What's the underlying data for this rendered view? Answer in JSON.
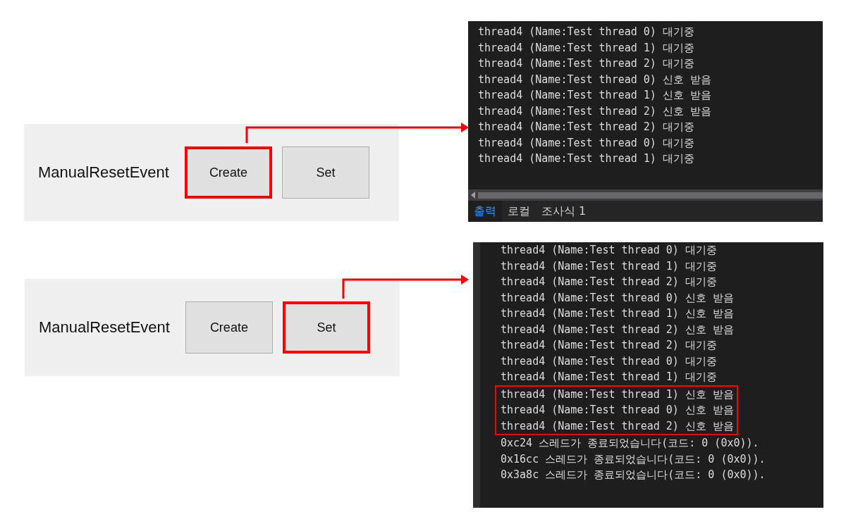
{
  "examples": [
    {
      "label": "ManualResetEvent",
      "buttons": [
        {
          "label": "Create",
          "highlighted": true
        },
        {
          "label": "Set",
          "highlighted": false
        }
      ],
      "output": {
        "lines": [
          {
            "text": "thread4 (Name:Test thread 0) 대기중",
            "highlighted": false
          },
          {
            "text": "thread4 (Name:Test thread 1) 대기중",
            "highlighted": false
          },
          {
            "text": "thread4 (Name:Test thread 2) 대기중",
            "highlighted": false
          },
          {
            "text": "thread4 (Name:Test thread 0) 신호 받음",
            "highlighted": false
          },
          {
            "text": "thread4 (Name:Test thread 1) 신호 받음",
            "highlighted": false
          },
          {
            "text": "thread4 (Name:Test thread 2) 신호 받음",
            "highlighted": false
          },
          {
            "text": "thread4 (Name:Test thread 2) 대기중",
            "highlighted": false
          },
          {
            "text": "thread4 (Name:Test thread 0) 대기중",
            "highlighted": false
          },
          {
            "text": "thread4 (Name:Test thread 1) 대기중",
            "highlighted": false
          }
        ],
        "tabs": [
          {
            "label": "출력",
            "selected": true
          },
          {
            "label": "로컬",
            "selected": false
          },
          {
            "label": "조사식 1",
            "selected": false
          }
        ]
      }
    },
    {
      "label": "ManualResetEvent",
      "buttons": [
        {
          "label": "Create",
          "highlighted": false
        },
        {
          "label": "Set",
          "highlighted": true
        }
      ],
      "output": {
        "lines": [
          {
            "text": "thread4 (Name:Test thread 0) 대기중",
            "highlighted": false
          },
          {
            "text": "thread4 (Name:Test thread 1) 대기중",
            "highlighted": false
          },
          {
            "text": "thread4 (Name:Test thread 2) 대기중",
            "highlighted": false
          },
          {
            "text": "thread4 (Name:Test thread 0) 신호 받음",
            "highlighted": false
          },
          {
            "text": "thread4 (Name:Test thread 1) 신호 받음",
            "highlighted": false
          },
          {
            "text": "thread4 (Name:Test thread 2) 신호 받음",
            "highlighted": false
          },
          {
            "text": "thread4 (Name:Test thread 2) 대기중",
            "highlighted": false
          },
          {
            "text": "thread4 (Name:Test thread 0) 대기중",
            "highlighted": false
          },
          {
            "text": "thread4 (Name:Test thread 1) 대기중",
            "highlighted": false
          },
          {
            "text": "thread4 (Name:Test thread 1) 신호 받음",
            "highlighted": true
          },
          {
            "text": "thread4 (Name:Test thread 0) 신호 받음",
            "highlighted": true
          },
          {
            "text": "thread4 (Name:Test thread 2) 신호 받음",
            "highlighted": true
          },
          {
            "text": "0xc24 스레드가 종료되었습니다(코드: 0 (0x0)).",
            "highlighted": false
          },
          {
            "text": "0x16cc 스레드가 종료되었습니다(코드: 0 (0x0)).",
            "highlighted": false
          },
          {
            "text": "0x3a8c 스레드가 종료되었습니다(코드: 0 (0x0)).",
            "highlighted": false
          }
        ]
      }
    }
  ]
}
